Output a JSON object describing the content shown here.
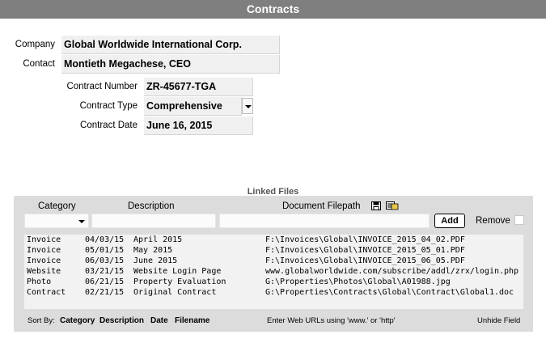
{
  "window": {
    "title": "Contracts"
  },
  "company": {
    "label": "Company",
    "value": "Global Worldwide International Corp."
  },
  "contact": {
    "label": "Contact",
    "value": "Montieth Megachese, CEO"
  },
  "contract_number": {
    "label": "Contract Number",
    "value": "ZR-45677-TGA"
  },
  "contract_type": {
    "label": "Contract Type",
    "value": "Comprehensive"
  },
  "contract_date": {
    "label": "Contract Date",
    "value": "June 16, 2015"
  },
  "linked_files": {
    "title": "Linked Files",
    "headers": {
      "category": "Category",
      "description": "Description",
      "filepath": "Document Filepath"
    },
    "add_label": "Add",
    "remove_label": "Remove",
    "files": [
      {
        "category": "Invoice",
        "date": "04/03/15",
        "description": "April 2015",
        "path": "F:\\Invoices\\Global\\INVOICE_2015_04_02.PDF"
      },
      {
        "category": "Invoice",
        "date": "05/01/15",
        "description": "May 2015",
        "path": "F:\\Invoices\\Global\\INVOICE_2015_05_01.PDF"
      },
      {
        "category": "Invoice",
        "date": "06/03/15",
        "description": "June 2015",
        "path": "F:\\Invoices\\Global\\INVOICE_2015_06_05.PDF"
      },
      {
        "category": "Website",
        "date": "03/21/15",
        "description": "Website Login Page",
        "path": "www.globalworldwide.com/subscribe/addl/zrx/login.php"
      },
      {
        "category": "Photo",
        "date": "06/21/15",
        "description": "Property Evaluation",
        "path": "G:\\Properties\\Photos\\Global\\A01988.jpg"
      },
      {
        "category": "Contract",
        "date": "02/21/15",
        "description": "Original Contract",
        "path": "G:\\Properties\\Contracts\\Global\\Contract\\Global1.doc"
      }
    ],
    "sort_by_label": "Sort By:",
    "sort_options": [
      "Category",
      "Description",
      "Date",
      "Filename"
    ],
    "hint": "Enter Web URLs using 'www.' or 'http'",
    "unhide_label": "Unhide Field"
  }
}
